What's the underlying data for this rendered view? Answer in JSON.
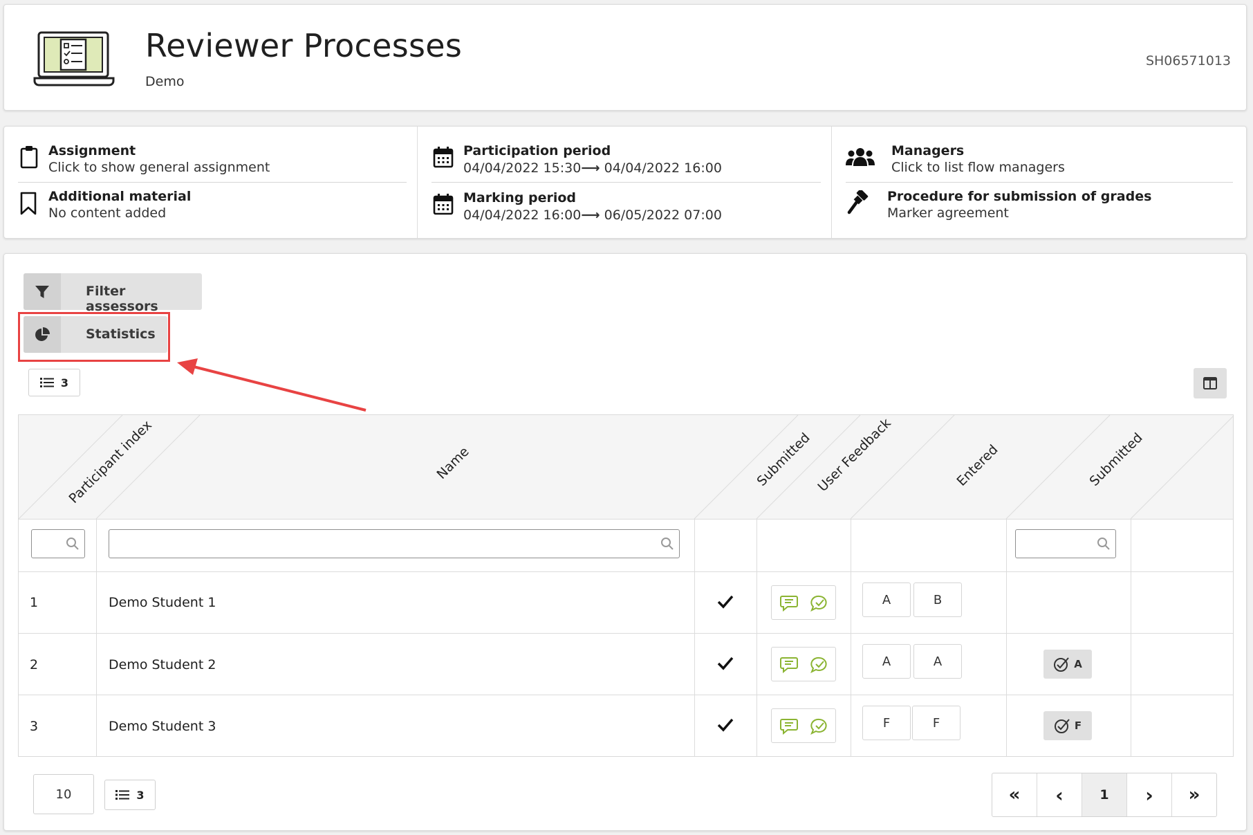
{
  "header": {
    "title": "Reviewer Processes",
    "subtitle": "Demo",
    "code": "SH06571013",
    "icon": "laptop-checklist-icon"
  },
  "info": {
    "assignment": {
      "title": "Assignment",
      "subtitle": "Click to show general assignment"
    },
    "additional_material": {
      "title": "Additional material",
      "subtitle": "No content added"
    },
    "participation_period": {
      "title": "Participation period",
      "start": "04/04/2022 15:30",
      "end": "04/04/2022 16:00"
    },
    "marking_period": {
      "title": "Marking period",
      "start": "04/04/2022 16:00",
      "end": "06/05/2022 07:00"
    },
    "managers": {
      "title": "Managers",
      "subtitle": "Click to list flow managers"
    },
    "grade_procedure": {
      "title": "Procedure for submission of grades",
      "subtitle": "Marker agreement"
    }
  },
  "toolbar": {
    "filter_label": "Filter assessors",
    "statistics_label": "Statistics",
    "count_top": "3"
  },
  "table": {
    "headers": [
      "Participant index",
      "Name",
      "Submitted",
      "User Feedback",
      "Entered",
      "Submitted"
    ],
    "rows": [
      {
        "index": "1",
        "name": "Demo Student 1",
        "submitted": true,
        "grades": [
          "A",
          "B"
        ],
        "final": ""
      },
      {
        "index": "2",
        "name": "Demo Student 2",
        "submitted": true,
        "grades": [
          "A",
          "A"
        ],
        "final": "A"
      },
      {
        "index": "3",
        "name": "Demo Student 3",
        "submitted": true,
        "grades": [
          "F",
          "F"
        ],
        "final": "F"
      }
    ]
  },
  "footer": {
    "page_size": "10",
    "count_bottom": "3",
    "pagination": {
      "first": "«",
      "prev": "‹",
      "current": "1",
      "next": "›",
      "last": "»"
    }
  },
  "colors": {
    "highlight": "#e84343",
    "feedback_icon": "#8bb432"
  }
}
